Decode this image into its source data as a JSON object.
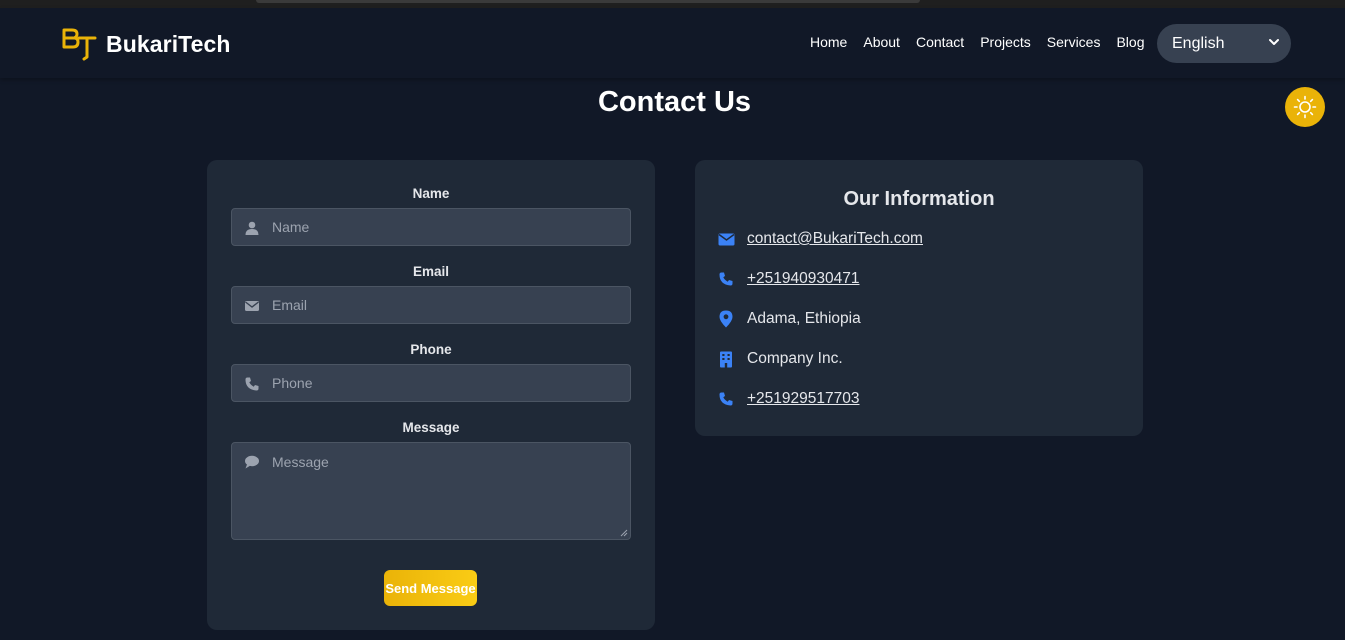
{
  "header": {
    "brand_name": "BukariTech",
    "nav": [
      "Home",
      "About",
      "Contact",
      "Projects",
      "Services",
      "Blog"
    ],
    "language": "English"
  },
  "page_title": "Contact Us",
  "form": {
    "name": {
      "label": "Name",
      "placeholder": "Name",
      "value": ""
    },
    "email": {
      "label": "Email",
      "placeholder": "Email",
      "value": ""
    },
    "phone": {
      "label": "Phone",
      "placeholder": "Phone",
      "value": ""
    },
    "message": {
      "label": "Message",
      "placeholder": "Message",
      "value": ""
    },
    "submit_label": "Send Message"
  },
  "info": {
    "title": "Our Information",
    "email": "contact@BukariTech.com",
    "phone1": "+251940930471",
    "location": "Adama, Ethiopia",
    "company": "Company Inc.",
    "phone2": "+251929517703"
  },
  "colors": {
    "background": "#111827",
    "card": "#1f2937",
    "accent": "#eab308",
    "icon_blue": "#3b82f6"
  },
  "icons": {
    "theme_toggle": "sun-icon",
    "name": "user-icon",
    "email": "envelope-icon",
    "phone": "phone-icon",
    "message": "comment-icon",
    "location": "map-pin-icon",
    "company": "building-icon"
  }
}
